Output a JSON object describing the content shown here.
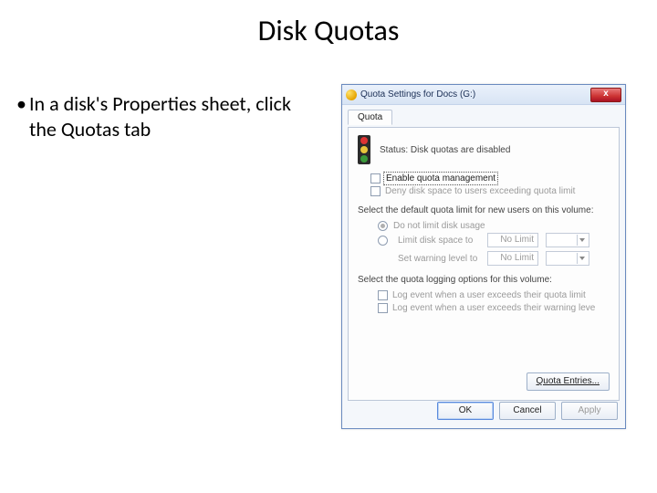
{
  "slide": {
    "title": "Disk Quotas",
    "bullet": "In a disk's Properties sheet, click the Quotas tab"
  },
  "dialog": {
    "title": "Quota Settings for Docs (G:)",
    "close_label": "x",
    "tab": "Quota",
    "status": "Status: Disk quotas are disabled",
    "enable_label": "Enable quota management",
    "deny_label": "Deny disk space to users exceeding quota limit",
    "default_limit_head": "Select the default quota limit for new users on this volume:",
    "radio_nolimit": "Do not limit disk usage",
    "radio_limit": "Limit disk space to",
    "warn_label": "Set warning level to",
    "limit_value": "No Limit",
    "warn_value": "No Limit",
    "unit_blank": "",
    "logging_head": "Select the quota logging options for this volume:",
    "log_exceed_limit": "Log event when a user exceeds their quota limit",
    "log_exceed_warn": "Log event when a user exceeds their warning leve",
    "quota_entries_btn": "Quota Entries...",
    "ok": "OK",
    "cancel": "Cancel",
    "apply": "Apply"
  }
}
